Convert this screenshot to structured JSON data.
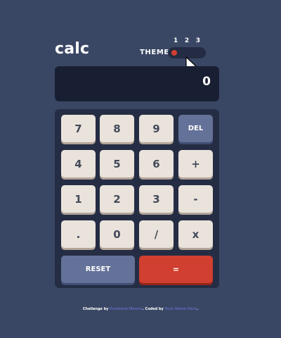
{
  "header": {
    "logo": "calc",
    "theme_label": "THEME",
    "theme_options": [
      "1",
      "2",
      "3"
    ],
    "selected_theme": 1
  },
  "display": {
    "value": "0"
  },
  "keys": [
    {
      "label": "7",
      "kind": "num"
    },
    {
      "label": "8",
      "kind": "num"
    },
    {
      "label": "9",
      "kind": "num"
    },
    {
      "label": "DEL",
      "kind": "fn"
    },
    {
      "label": "4",
      "kind": "num"
    },
    {
      "label": "5",
      "kind": "num"
    },
    {
      "label": "6",
      "kind": "num"
    },
    {
      "label": "+",
      "kind": "num"
    },
    {
      "label": "1",
      "kind": "num"
    },
    {
      "label": "2",
      "kind": "num"
    },
    {
      "label": "3",
      "kind": "num"
    },
    {
      "label": "-",
      "kind": "num"
    },
    {
      "label": ".",
      "kind": "num"
    },
    {
      "label": "0",
      "kind": "num"
    },
    {
      "label": "/",
      "kind": "num"
    },
    {
      "label": "x",
      "kind": "num"
    },
    {
      "label": "RESET",
      "kind": "fn"
    },
    {
      "label": "=",
      "kind": "eq"
    }
  ],
  "footer": {
    "prefix": "Challenge by",
    "challenge_link": "Frontend Mentor",
    "middle": ". Coded by",
    "author_link": "Your Name Here",
    "suffix": "."
  },
  "colors": {
    "background": "#3a4764",
    "screen": "#181f32",
    "keypad": "#252d44",
    "key": "#eae3dc",
    "key_fn": "#647198",
    "key_equals": "#d03f2f"
  }
}
